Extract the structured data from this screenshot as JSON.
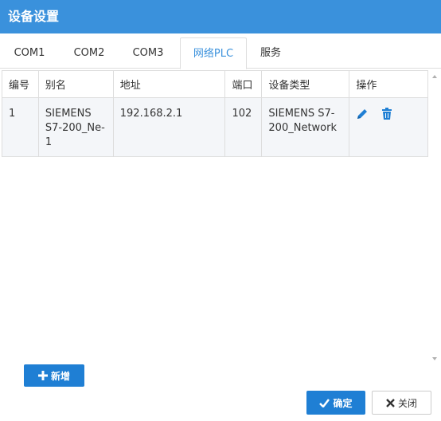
{
  "window": {
    "title": "设备设置"
  },
  "tabs": [
    {
      "label": "COM1",
      "active": false
    },
    {
      "label": "COM2",
      "active": false
    },
    {
      "label": "COM3",
      "active": false
    },
    {
      "label": "网络PLC",
      "active": true
    },
    {
      "label": "服务",
      "active": false
    }
  ],
  "table": {
    "headers": [
      "编号",
      "别名",
      "地址",
      "端口",
      "设备类型",
      "操作"
    ],
    "rows": [
      {
        "id": "1",
        "alias": "SIEMENS S7-200_Ne-1",
        "address": "192.168.2.1",
        "port": "102",
        "device_type": "SIEMENS S7-200_Network",
        "actions": [
          "pencil-icon",
          "trash-icon"
        ]
      }
    ]
  },
  "buttons": {
    "add": "新增",
    "ok": "确定",
    "close": "关闭"
  },
  "colors": {
    "accent": "#3a91dc",
    "button": "#1f7fd4",
    "row_bg": "#f4f6f9"
  }
}
